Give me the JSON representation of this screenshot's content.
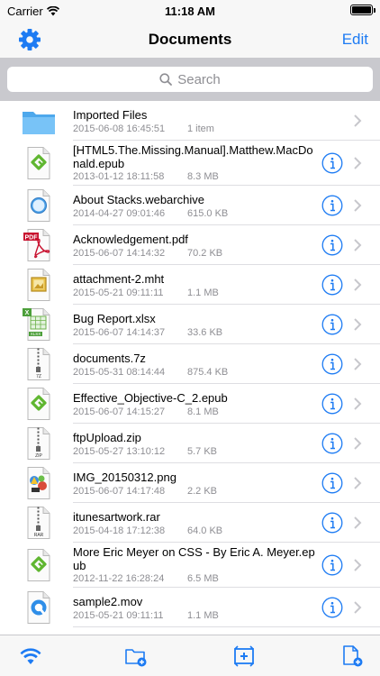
{
  "status": {
    "carrier": "Carrier",
    "time": "11:18 AM",
    "battery_level": 1.0
  },
  "nav": {
    "title": "Documents",
    "edit_label": "Edit",
    "settings_icon": "gear-icon"
  },
  "search": {
    "placeholder": "Search"
  },
  "colors": {
    "accent": "#1d7bf3",
    "meta": "#8e8e93",
    "separator": "#dedee2"
  },
  "files": [
    {
      "name": "Imported Files",
      "date": "2015-06-08 16:45:51",
      "size": "1 item",
      "icon": "folder-icon",
      "info": false
    },
    {
      "name": "[HTML5.The.Missing.Manual].Matthew.MacDonald.epub",
      "date": "2013-01-12 18:11:58",
      "size": "8.3 MB",
      "icon": "epub-icon",
      "info": true
    },
    {
      "name": "About Stacks.webarchive",
      "date": "2014-04-27 09:01:46",
      "size": "615.0 KB",
      "icon": "safari-icon",
      "info": true
    },
    {
      "name": "Acknowledgement.pdf",
      "date": "2015-06-07 14:14:32",
      "size": "70.2 KB",
      "icon": "pdf-icon",
      "info": true
    },
    {
      "name": "attachment-2.mht",
      "date": "2015-05-21 09:11:11",
      "size": "1.1 MB",
      "icon": "picture-icon",
      "info": true
    },
    {
      "name": "Bug Report.xlsx",
      "date": "2015-06-07 14:14:37",
      "size": "33.6 KB",
      "icon": "xlsx-icon",
      "info": true
    },
    {
      "name": "documents.7z",
      "date": "2015-05-31 08:14:44",
      "size": "875.4 KB",
      "icon": "archive-7z-icon",
      "info": true
    },
    {
      "name": "Effective_Objective-C_2.epub",
      "date": "2015-06-07 14:15:27",
      "size": "8.1 MB",
      "icon": "epub-icon",
      "info": true
    },
    {
      "name": "ftpUpload.zip",
      "date": "2015-05-27 13:10:12",
      "size": "5.7 KB",
      "icon": "archive-zip-icon",
      "info": true
    },
    {
      "name": "IMG_20150312.png",
      "date": "2015-06-07 14:17:48",
      "size": "2.2 KB",
      "icon": "image-icon",
      "info": true
    },
    {
      "name": "itunesartwork.rar",
      "date": "2015-04-18 17:12:38",
      "size": "64.0 KB",
      "icon": "archive-rar-icon",
      "info": true
    },
    {
      "name": "More Eric Meyer on CSS - By Eric A. Meyer.epub",
      "date": "2012-11-22 16:28:24",
      "size": "6.5 MB",
      "icon": "epub-icon",
      "info": true
    },
    {
      "name": "sample2.mov",
      "date": "2015-05-21 09:11:11",
      "size": "1.1 MB",
      "icon": "quicktime-icon",
      "info": true
    }
  ],
  "tabs": [
    {
      "icon": "wifi-icon"
    },
    {
      "icon": "new-folder-icon"
    },
    {
      "icon": "photo-import-icon"
    },
    {
      "icon": "new-file-icon"
    }
  ]
}
